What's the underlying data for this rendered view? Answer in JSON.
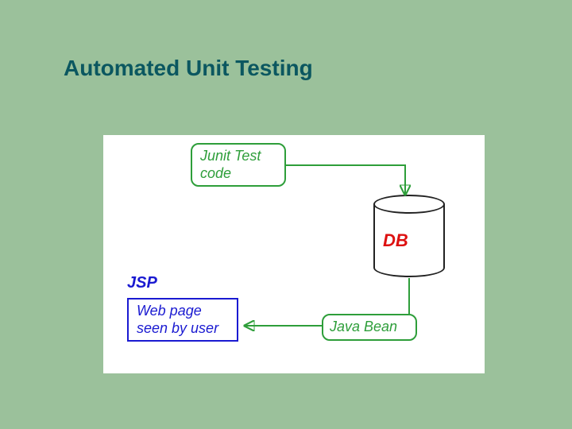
{
  "title": "Automated Unit Testing",
  "diagram": {
    "junit_box": "Junit Test code",
    "jsp_label": "JSP",
    "webpage_box": "Web page seen by user",
    "db_label": "DB",
    "javabean_box": "Java Bean"
  },
  "colors": {
    "page_bg": "#9bc19b",
    "title": "#0b5760",
    "green": "#2e9e3a",
    "blue": "#1a1ad1",
    "red": "#d11",
    "black": "#222"
  }
}
